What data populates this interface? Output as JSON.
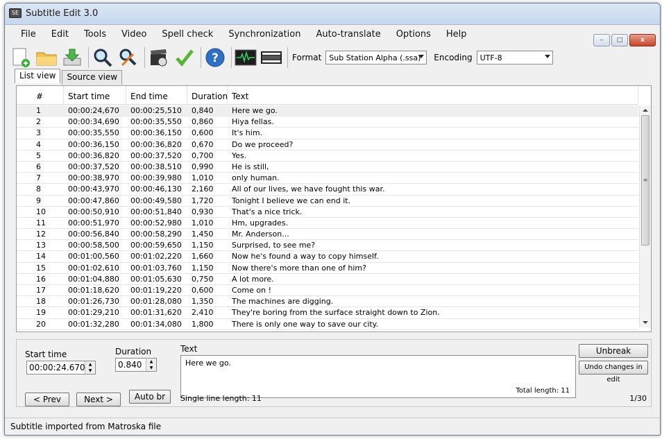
{
  "app": {
    "title": "Subtitle Edit 3.0",
    "icon_text": "SE"
  },
  "window_buttons": {
    "minimize": "–",
    "maximize": "□",
    "close": "x"
  },
  "menu": [
    "File",
    "Edit",
    "Tools",
    "Video",
    "Spell check",
    "Synchronization",
    "Auto-translate",
    "Options",
    "Help"
  ],
  "toolbar": {
    "icons": [
      "new-file-icon",
      "open-folder-icon",
      "download-icon",
      "find-icon",
      "replace-icon",
      "video-clapper-icon",
      "checkmark-icon",
      "help-icon",
      "waveform-icon",
      "film-strip-icon"
    ],
    "format_label": "Format",
    "format_value": "Sub Station Alpha (.ssa)",
    "encoding_label": "Encoding",
    "encoding_value": "UTF-8"
  },
  "tabs": [
    "List view",
    "Source view"
  ],
  "list": {
    "columns": [
      "#",
      "Start time",
      "End time",
      "Duration",
      "Text"
    ],
    "rows": [
      [
        "1",
        "00:00:24,670",
        "00:00:25,510",
        "0,840",
        "Here we go."
      ],
      [
        "2",
        "00:00:34,690",
        "00:00:35,550",
        "0,860",
        "Hiya fellas."
      ],
      [
        "3",
        "00:00:35,550",
        "00:00:36,150",
        "0,600",
        "It's him."
      ],
      [
        "4",
        "00:00:36,150",
        "00:00:36,820",
        "0,670",
        "Do we proceed?"
      ],
      [
        "5",
        "00:00:36,820",
        "00:00:37,520",
        "0,700",
        "Yes."
      ],
      [
        "6",
        "00:00:37,520",
        "00:00:38,510",
        "0,990",
        "He is still,"
      ],
      [
        "7",
        "00:00:38,970",
        "00:00:39,980",
        "1,010",
        "only human."
      ],
      [
        "8",
        "00:00:43,970",
        "00:00:46,130",
        "2,160",
        "All of our lives, we have fought this war."
      ],
      [
        "9",
        "00:00:47,860",
        "00:00:49,580",
        "1,720",
        "Tonight I believe we can end it."
      ],
      [
        "10",
        "00:00:50,910",
        "00:00:51,840",
        "0,930",
        "That's a nice trick."
      ],
      [
        "11",
        "00:00:51,970",
        "00:00:52,980",
        "1,010",
        "Hm, upgrades."
      ],
      [
        "12",
        "00:00:56,840",
        "00:00:58,290",
        "1,450",
        "Mr. Anderson..."
      ],
      [
        "13",
        "00:00:58,500",
        "00:00:59,650",
        "1,150",
        "Surprised, to see me?"
      ],
      [
        "14",
        "00:01:00,560",
        "00:01:02,220",
        "1,660",
        "Now he's found a way to copy himself."
      ],
      [
        "15",
        "00:01:02,610",
        "00:01:03,760",
        "1,150",
        "Now there's more than one of him?"
      ],
      [
        "16",
        "00:01:04,880",
        "00:01:05,630",
        "0,750",
        "A lot more."
      ],
      [
        "17",
        "00:01:18,620",
        "00:01:19,220",
        "0,600",
        "Come on !"
      ],
      [
        "18",
        "00:01:26,730",
        "00:01:28,080",
        "1,350",
        "The machines are digging."
      ],
      [
        "19",
        "00:01:29,210",
        "00:01:31,620",
        "2,410",
        "They're boring from the surface straight down to Zion."
      ],
      [
        "20",
        "00:01:32,280",
        "00:01:34,080",
        "1,800",
        "There is only one way to save our city."
      ]
    ]
  },
  "edit": {
    "start_time_label": "Start time",
    "start_time_value": "00:00:24.670",
    "duration_label": "Duration",
    "duration_value": "0.840",
    "text_label": "Text",
    "text_value": "Here we go.",
    "total_length": "Total length: 11",
    "single_line_length": "Single line length: 11",
    "unbreak": "Unbreak",
    "undo_changes": "Undo changes in edit",
    "prev": "< Prev",
    "next": "Next >",
    "auto_br": "Auto br",
    "position": "1/30"
  },
  "status": "Subtitle imported from Matroska file"
}
